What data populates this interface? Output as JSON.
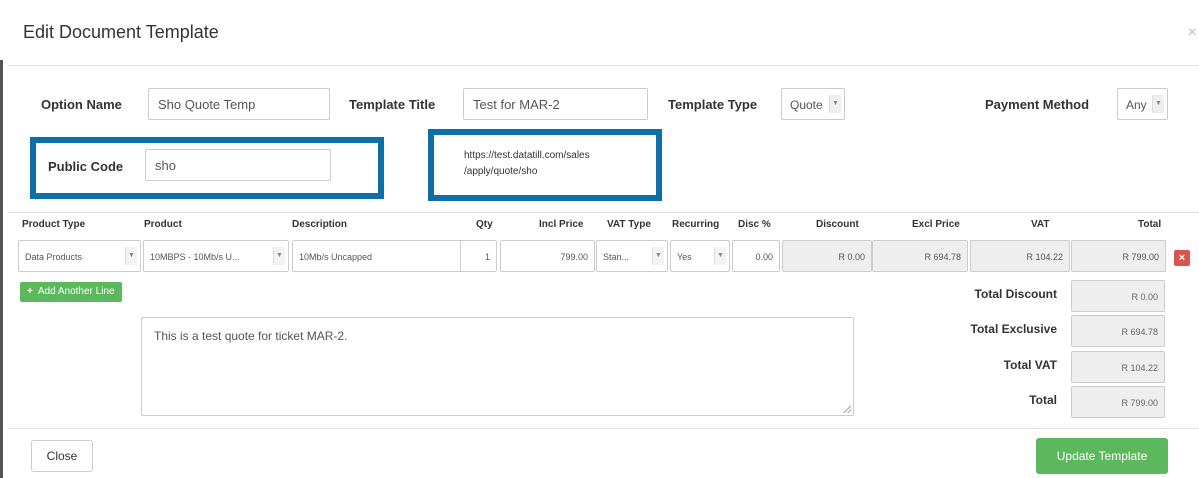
{
  "modal": {
    "title": "Edit Document Template",
    "close_symbol": "×"
  },
  "form": {
    "option_name_label": "Option Name",
    "option_name_value": "Sho Quote Temp",
    "template_title_label": "Template Title",
    "template_title_value": "Test for MAR-2",
    "template_type_label": "Template Type",
    "template_type_value": "Quote",
    "payment_method_label": "Payment Method",
    "payment_method_value": "Any",
    "public_code_label": "Public Code",
    "public_code_value": "sho",
    "public_url_line1": "https://test.datatill.com/sales",
    "public_url_line2": "/apply/quote/sho"
  },
  "table": {
    "headers": [
      "Product Type",
      "Product",
      "Description",
      "Qty",
      "Incl Price",
      "VAT Type",
      "Recurring",
      "Disc %",
      "Discount",
      "Excl Price",
      "VAT",
      "Total"
    ],
    "row": {
      "product_type": "Data Products",
      "product": "10MBPS - 10Mb/s U...",
      "description": "10Mb/s Uncapped",
      "qty": "1",
      "incl_price": "799.00",
      "vat_type": "Stan...",
      "recurring": "Yes",
      "disc_pct": "0.00",
      "discount": "R 0.00",
      "excl_price": "R 694.78",
      "vat": "R 104.22",
      "total": "R 799.00"
    },
    "delete_symbol": "×",
    "add_line_label": "Add Another Line"
  },
  "notes": {
    "text": "This is a test quote for ticket MAR-2."
  },
  "totals": {
    "total_discount_label": "Total Discount",
    "total_discount_value": "R 0.00",
    "total_exclusive_label": "Total Exclusive",
    "total_exclusive_value": "R 694.78",
    "total_vat_label": "Total VAT",
    "total_vat_value": "R 104.22",
    "total_label": "Total",
    "total_value": "R 799.00"
  },
  "footer": {
    "close_label": "Close",
    "update_label": "Update Template"
  },
  "colors": {
    "highlight": "#0d6ea8",
    "success": "#5cb85c",
    "danger": "#d9534f"
  }
}
